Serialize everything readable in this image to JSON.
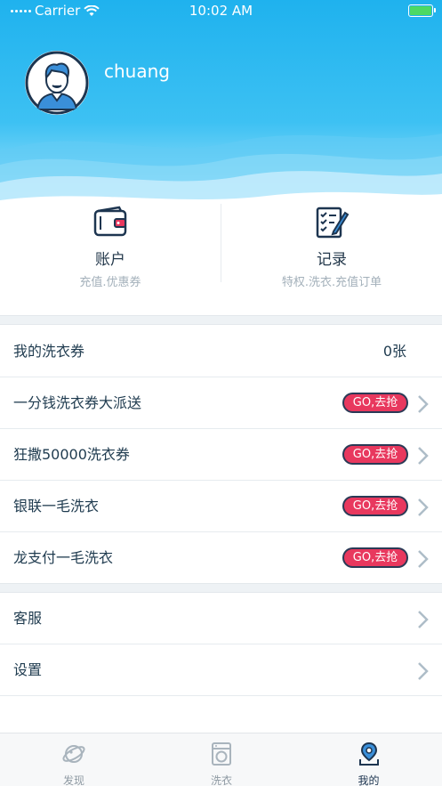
{
  "status_bar": {
    "carrier": "Carrier",
    "time": "10:02 AM"
  },
  "profile": {
    "username": "chuang",
    "avatar_icon": "user-avatar-icon"
  },
  "quick_actions": [
    {
      "icon": "wallet-icon",
      "title": "账户",
      "subtitle": "充值.优惠券"
    },
    {
      "icon": "record-checklist-icon",
      "title": "记录",
      "subtitle": "特权.洗衣.充值订单"
    }
  ],
  "coupons": {
    "label": "我的洗衣券",
    "value": "0张"
  },
  "promotions": [
    {
      "label": "一分钱洗衣券大派送",
      "action": "GO,去抢"
    },
    {
      "label": "狂撒50000洗衣券",
      "action": "GO,去抢"
    },
    {
      "label": "银联一毛洗衣",
      "action": "GO,去抢"
    },
    {
      "label": "龙支付一毛洗衣",
      "action": "GO,去抢"
    }
  ],
  "settings": [
    {
      "label": "客服"
    },
    {
      "label": "设置"
    }
  ],
  "tabs": [
    {
      "label": "发现",
      "icon": "discover-planet-icon",
      "active": false
    },
    {
      "label": "洗衣",
      "icon": "washing-machine-icon",
      "active": false
    },
    {
      "label": "我的",
      "icon": "profile-pin-icon",
      "active": true
    }
  ],
  "colors": {
    "header": "#1fb2ee",
    "badge": "#e8385e",
    "text": "#1f3b4f",
    "muted": "#a3b0ba"
  }
}
